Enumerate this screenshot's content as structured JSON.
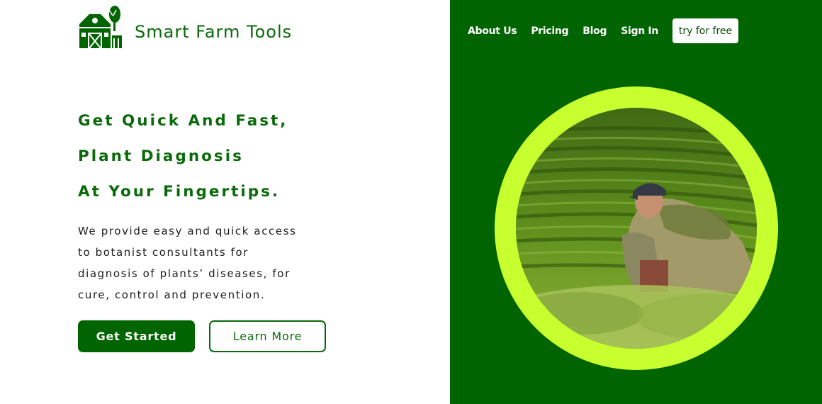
{
  "brand": {
    "name": "Smart Farm Tools",
    "logo_icon": "barn-windmill-icon",
    "color": "#0a6a0a"
  },
  "nav": {
    "links": [
      "About Us",
      "Pricing",
      "Blog",
      "Sign In"
    ],
    "cta_label": "try for free"
  },
  "hero": {
    "headline_lines": [
      "Get Quick And Fast,",
      "Plant Diagnosis",
      "At Your Fingertips."
    ],
    "description_lines": [
      "We provide easy and quick access",
      "to botanist consultants for",
      "diagnosis of plants’ diseases, for",
      "cure, control and prevention."
    ],
    "primary_button": "Get Started",
    "secondary_button": "Learn More",
    "image_subject": "farmer-in-tea-field-photo"
  },
  "colors": {
    "dark_green": "#006400",
    "accent_lime": "#c8ff2e",
    "background": "#ffffff"
  }
}
